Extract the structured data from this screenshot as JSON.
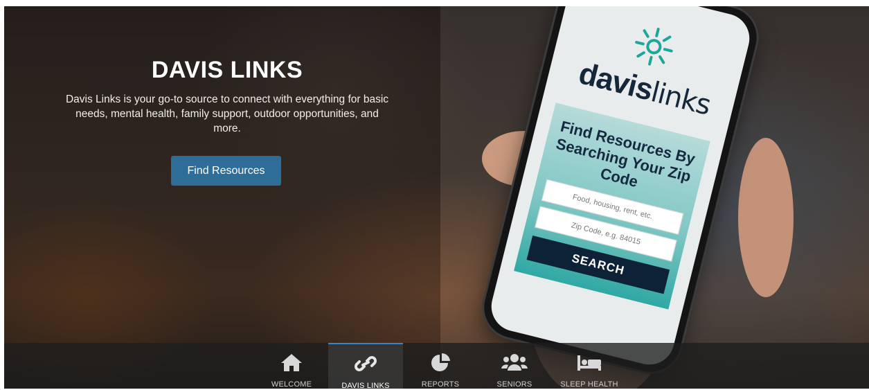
{
  "hero": {
    "title": "DAVIS LINKS",
    "description": "Davis Links is your go-to source to connect with everything for basic needs, mental health, family support, outdoor opportunities, and more.",
    "cta_label": "Find Resources"
  },
  "phone": {
    "logo_text_bold": "davis",
    "logo_text_light": "links",
    "card_heading": "Find Resources By Searching Your Zip Code",
    "topic_placeholder": "Food, housing, rent, etc.",
    "zip_placeholder": "Zip Code, e.g. 84015",
    "search_label": "SEARCH"
  },
  "nav": {
    "items": [
      {
        "label": "WELCOME",
        "icon": "home-icon"
      },
      {
        "label": "DAVIS LINKS",
        "icon": "link-icon",
        "active": true
      },
      {
        "label": "REPORTS",
        "icon": "pie-chart-icon"
      },
      {
        "label": "SENIORS",
        "icon": "users-icon"
      },
      {
        "label": "SLEEP HEALTH",
        "icon": "bed-icon"
      }
    ]
  },
  "colors": {
    "cta": "#2e6d98",
    "nav_active_border": "#3b86c4",
    "logo_teal": "#1fa69a",
    "logo_navy": "#15283a"
  }
}
